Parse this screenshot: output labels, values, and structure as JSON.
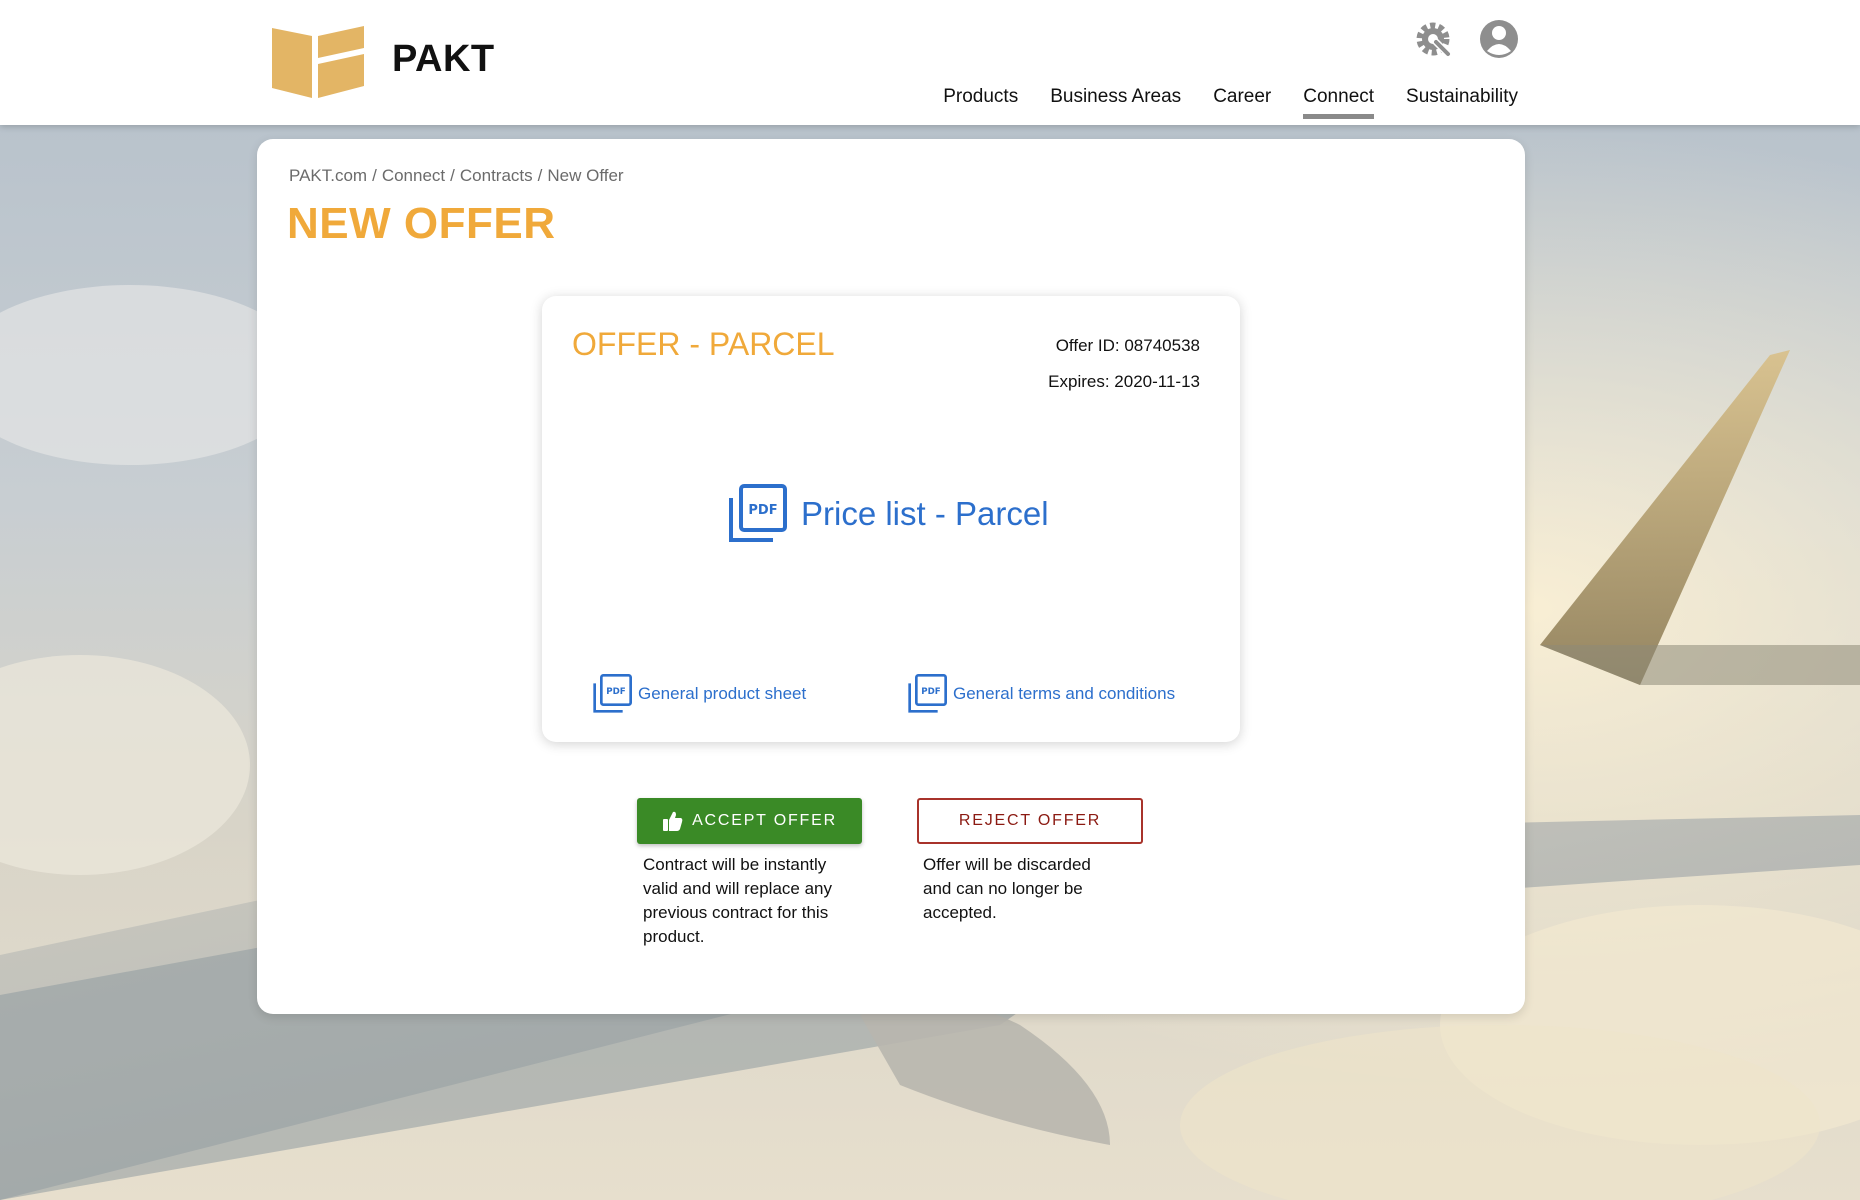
{
  "header": {
    "brand": "PAKT",
    "nav": [
      {
        "label": "Products"
      },
      {
        "label": "Business Areas"
      },
      {
        "label": "Career"
      },
      {
        "label": "Connect",
        "active": true
      },
      {
        "label": "Sustainability"
      }
    ],
    "icons": [
      "settings-tools-icon",
      "user-account-icon"
    ]
  },
  "breadcrumb": [
    "PAKT.com",
    "Connect",
    "Contracts",
    "New Offer"
  ],
  "page_title": "NEW OFFER",
  "offer": {
    "title": "OFFER - PARCEL",
    "offer_id": "Offer ID: 08740538",
    "expires": "Expires: 2020-11-13",
    "main_document": "Price list - Parcel",
    "documents": [
      "General product sheet",
      "General terms and conditions"
    ]
  },
  "actions": {
    "accept_label": "ACCEPT OFFER",
    "accept_note": "Contract will be instantly valid and will replace any previous contract for this product.",
    "reject_label": "REJECT OFFER",
    "reject_note": "Offer will be discarded and can no longer be accepted."
  },
  "colors": {
    "accent_orange": "#f0a93a",
    "link_blue": "#2c6fcc",
    "accept_green": "#3a8a26",
    "reject_red": "#8b1a12",
    "logo_gold": "#e3b565"
  }
}
